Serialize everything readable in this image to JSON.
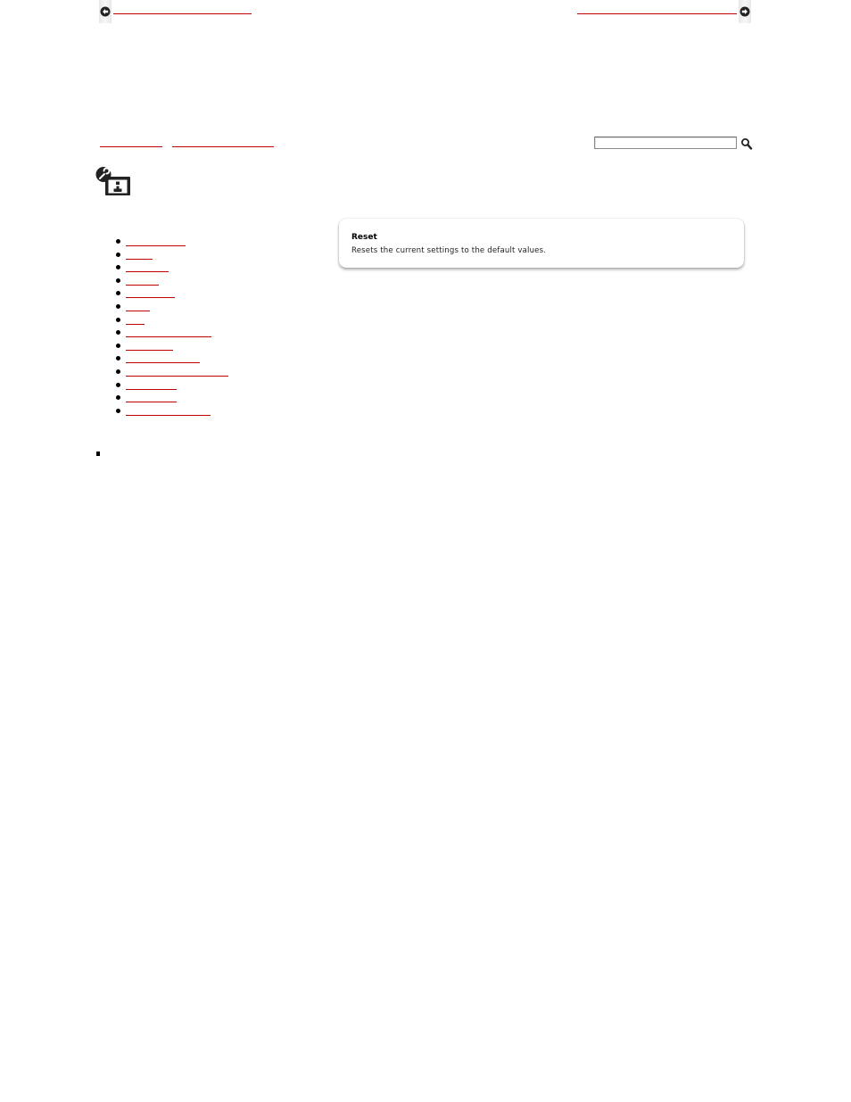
{
  "breadcrumb": {
    "items": [
      "",
      ""
    ]
  },
  "search": {
    "value": "",
    "placeholder": "",
    "button_icon": "search-icon"
  },
  "header": {
    "icon": "settings-icon"
  },
  "nav": {
    "items": [
      "",
      "",
      "",
      "",
      "",
      "",
      "",
      "",
      "",
      "",
      "",
      "",
      "",
      ""
    ]
  },
  "card": {
    "title": "Reset",
    "description": "Resets the current settings to the default values."
  },
  "pager": {
    "prev_label": "",
    "next_label": "",
    "prev_icon": "arrow-left-circle-icon",
    "next_icon": "arrow-right-circle-icon"
  },
  "colors": {
    "link": "#c00000",
    "text": "#000000",
    "background": "#ffffff"
  }
}
